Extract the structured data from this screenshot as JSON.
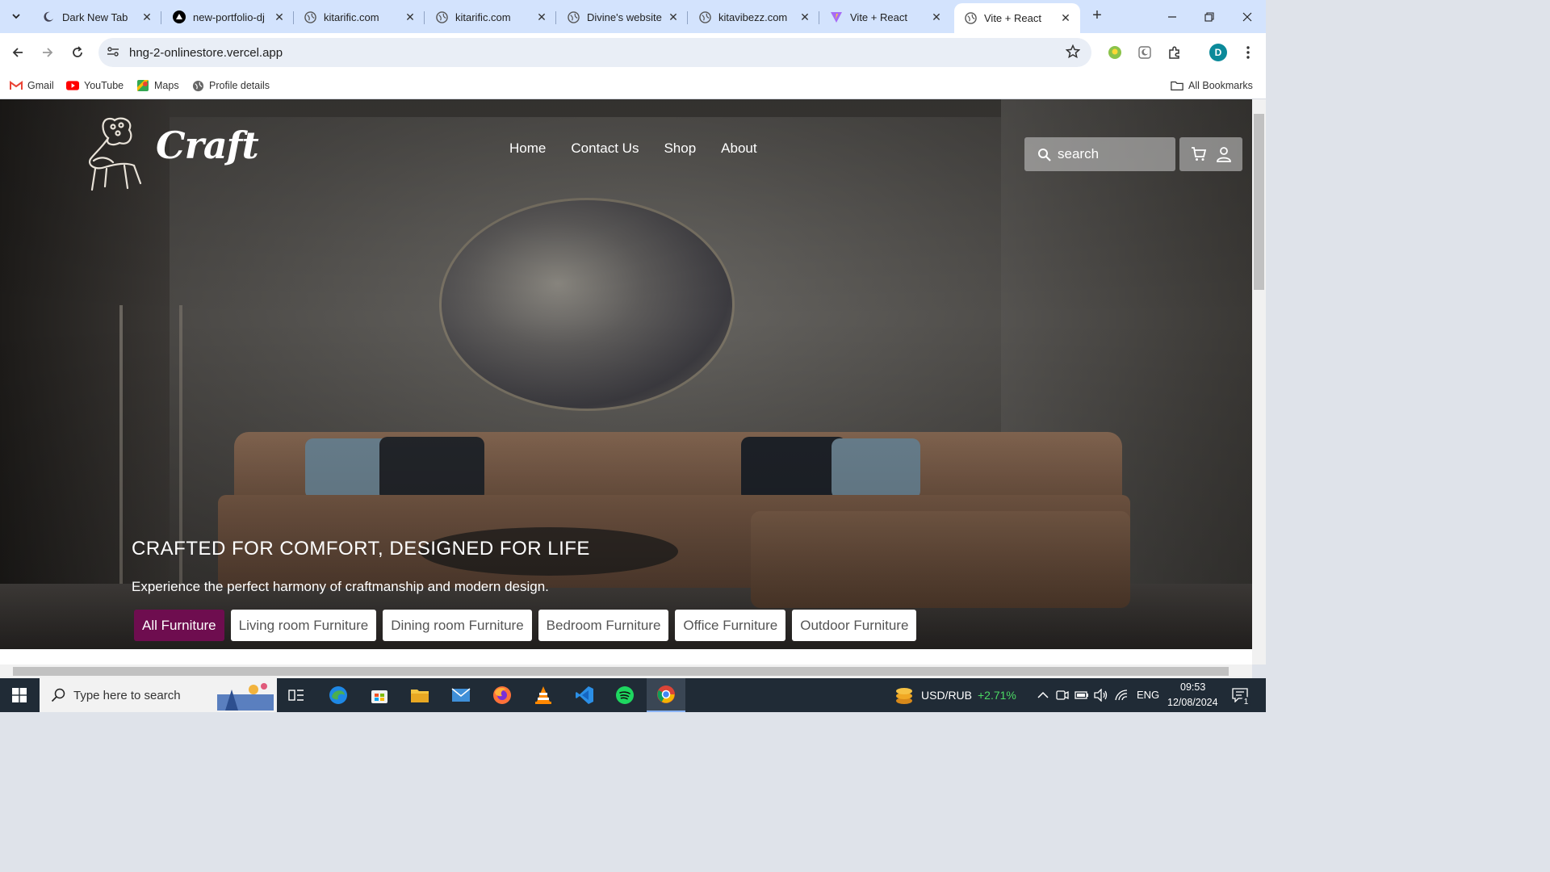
{
  "browser": {
    "tabs": [
      {
        "title": "Dark New Tab",
        "active": false
      },
      {
        "title": "new-portfolio-dj",
        "active": false
      },
      {
        "title": "kitarific.com",
        "active": false
      },
      {
        "title": "kitarific.com",
        "active": false
      },
      {
        "title": "Divine's website",
        "active": false
      },
      {
        "title": "kitavibezz.com",
        "active": false
      },
      {
        "title": "Vite + React",
        "active": false
      },
      {
        "title": "Vite + React",
        "active": true
      }
    ],
    "url": "hng-2-onlinestore.vercel.app",
    "profile_initial": "D",
    "bookmarks": [
      {
        "label": "Gmail",
        "icon": "gmail-icon"
      },
      {
        "label": "YouTube",
        "icon": "youtube-icon"
      },
      {
        "label": "Maps",
        "icon": "maps-icon"
      },
      {
        "label": "Profile details",
        "icon": "globe-icon"
      }
    ],
    "all_bookmarks_label": "All Bookmarks"
  },
  "site": {
    "logo_text": "Craft",
    "nav": [
      "Home",
      "Contact Us",
      "Shop",
      "About"
    ],
    "search_placeholder": "search",
    "hero_title": "CRAFTED FOR COMFORT, DESIGNED FOR LIFE",
    "hero_subtitle": "Experience the perfect harmony of craftmanship and modern design.",
    "categories": [
      {
        "label": "All Furniture",
        "active": true
      },
      {
        "label": "Living room Furniture",
        "active": false
      },
      {
        "label": "Dining room Furniture",
        "active": false
      },
      {
        "label": "Bedroom Furniture",
        "active": false
      },
      {
        "label": "Office Furniture",
        "active": false
      },
      {
        "label": "Outdoor Furniture",
        "active": false
      }
    ],
    "accent_color": "#6e0d4f"
  },
  "taskbar": {
    "search_placeholder": "Type here to search",
    "ticker_label": "USD/RUB",
    "ticker_change": "+2.71%",
    "language": "ENG",
    "time": "09:53",
    "date": "12/08/2024",
    "notification_count": "1"
  }
}
